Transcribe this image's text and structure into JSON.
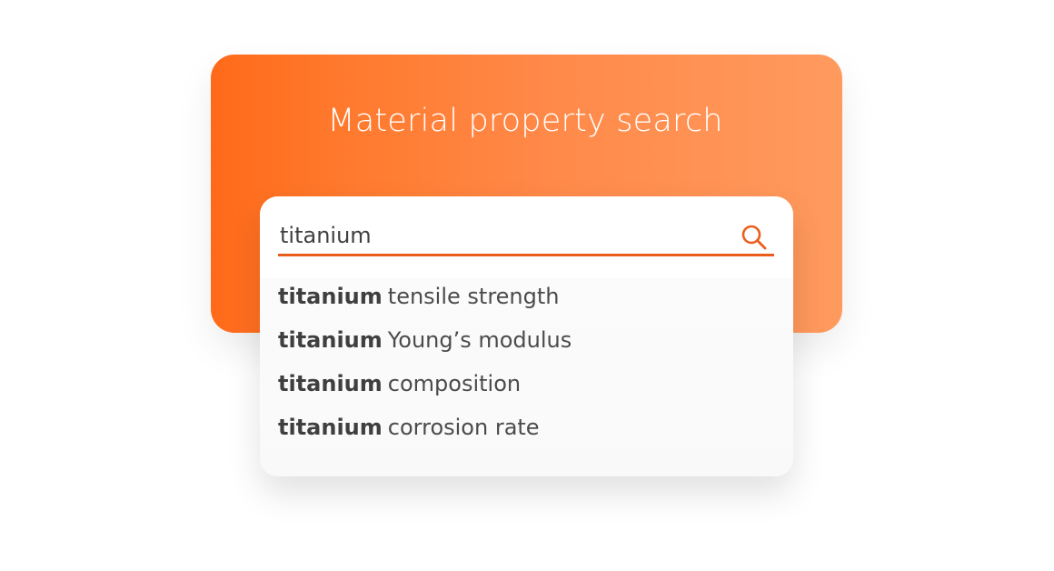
{
  "header": {
    "title": "Material property search"
  },
  "search": {
    "value": "titanium",
    "placeholder": ""
  },
  "suggestions": [
    {
      "prefix": "titanium",
      "suffix": "tensile strength"
    },
    {
      "prefix": "titanium",
      "suffix": "Young’s modulus"
    },
    {
      "prefix": "titanium",
      "suffix": "composition"
    },
    {
      "prefix": "titanium",
      "suffix": "corrosion rate"
    }
  ],
  "colors": {
    "accent": "#ea5e1c",
    "gradient_start": "#ff6a1a",
    "gradient_end": "#ff9a5e"
  },
  "icons": {
    "search": "search-icon"
  }
}
